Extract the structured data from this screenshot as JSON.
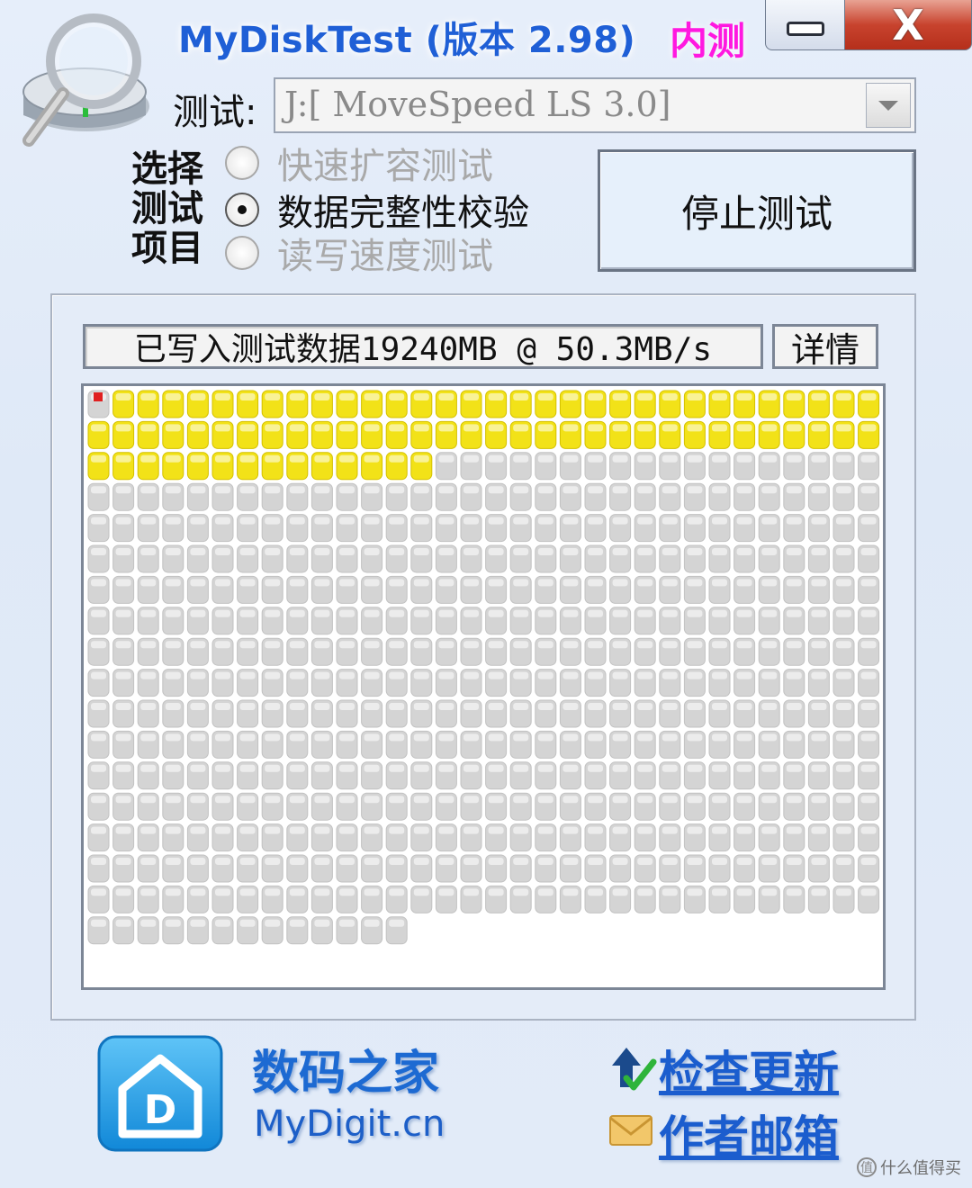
{
  "window": {
    "title": "MyDiskTest (版本 2.98)",
    "beta_label": "内测",
    "minimize_icon": "minimize-icon",
    "close_label": "X"
  },
  "drive": {
    "label": "测试:",
    "selected": "J:[ MoveSpeed LS 3.0]"
  },
  "options": {
    "label": "选择测试项目",
    "items": [
      {
        "label": "快速扩容测试",
        "checked": false,
        "enabled": false
      },
      {
        "label": "数据完整性校验",
        "checked": true,
        "enabled": true
      },
      {
        "label": "读写速度测试",
        "checked": false,
        "enabled": false
      }
    ]
  },
  "stop_button": "停止测试",
  "status": {
    "text": "已写入测试数据19240MB @ 50.3MB/s",
    "detail_button": "详情"
  },
  "progress_grid": {
    "columns": 32,
    "total_blocks": 557,
    "written_blocks": 78,
    "error_blocks": [
      0
    ],
    "colors": {
      "written": "#f2e218",
      "pending": "#d4d4d4",
      "error": "#e02020"
    }
  },
  "footer": {
    "brand_cn": "数码之家",
    "brand_en": "MyDigit.cn",
    "update_link": "检查更新",
    "email_link": "作者邮箱",
    "watermark": "什么值得买"
  },
  "colors": {
    "title": "#1f5fd6",
    "beta": "#ff18e0",
    "link": "#1b5dce"
  }
}
